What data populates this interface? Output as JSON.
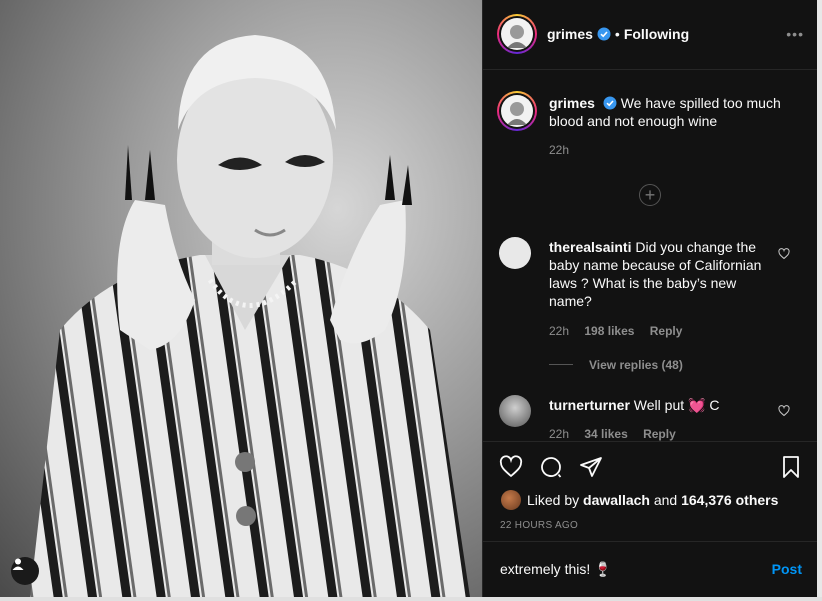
{
  "post": {
    "author": "grimes",
    "separator": "•",
    "follow_status": "Following",
    "more_icon": "more-horizontal-icon"
  },
  "caption": {
    "username": "grimes",
    "text": "We have spilled too much blood and not enough wine",
    "time": "22h"
  },
  "comments": [
    {
      "username": "therealsainti",
      "text": "Did you change the baby name because of Californian laws ? What is the baby’s new name?",
      "time": "22h",
      "likes": "198 likes",
      "reply": "Reply",
      "view_replies": "View replies (48)"
    },
    {
      "username": "turnerturner",
      "text": "Well put 💓 C",
      "time": "22h",
      "likes": "34 likes",
      "reply": "Reply"
    }
  ],
  "likes": {
    "prefix": "Liked by",
    "user": "dawallach",
    "middle": "and",
    "count": "164,376 others"
  },
  "timestamp": "22 HOURS AGO",
  "composer": {
    "value": "extremely this! 🍷",
    "post_label": "Post"
  },
  "colors": {
    "accent": "#0095f6",
    "background": "#121212",
    "verified": "#3897f0"
  }
}
